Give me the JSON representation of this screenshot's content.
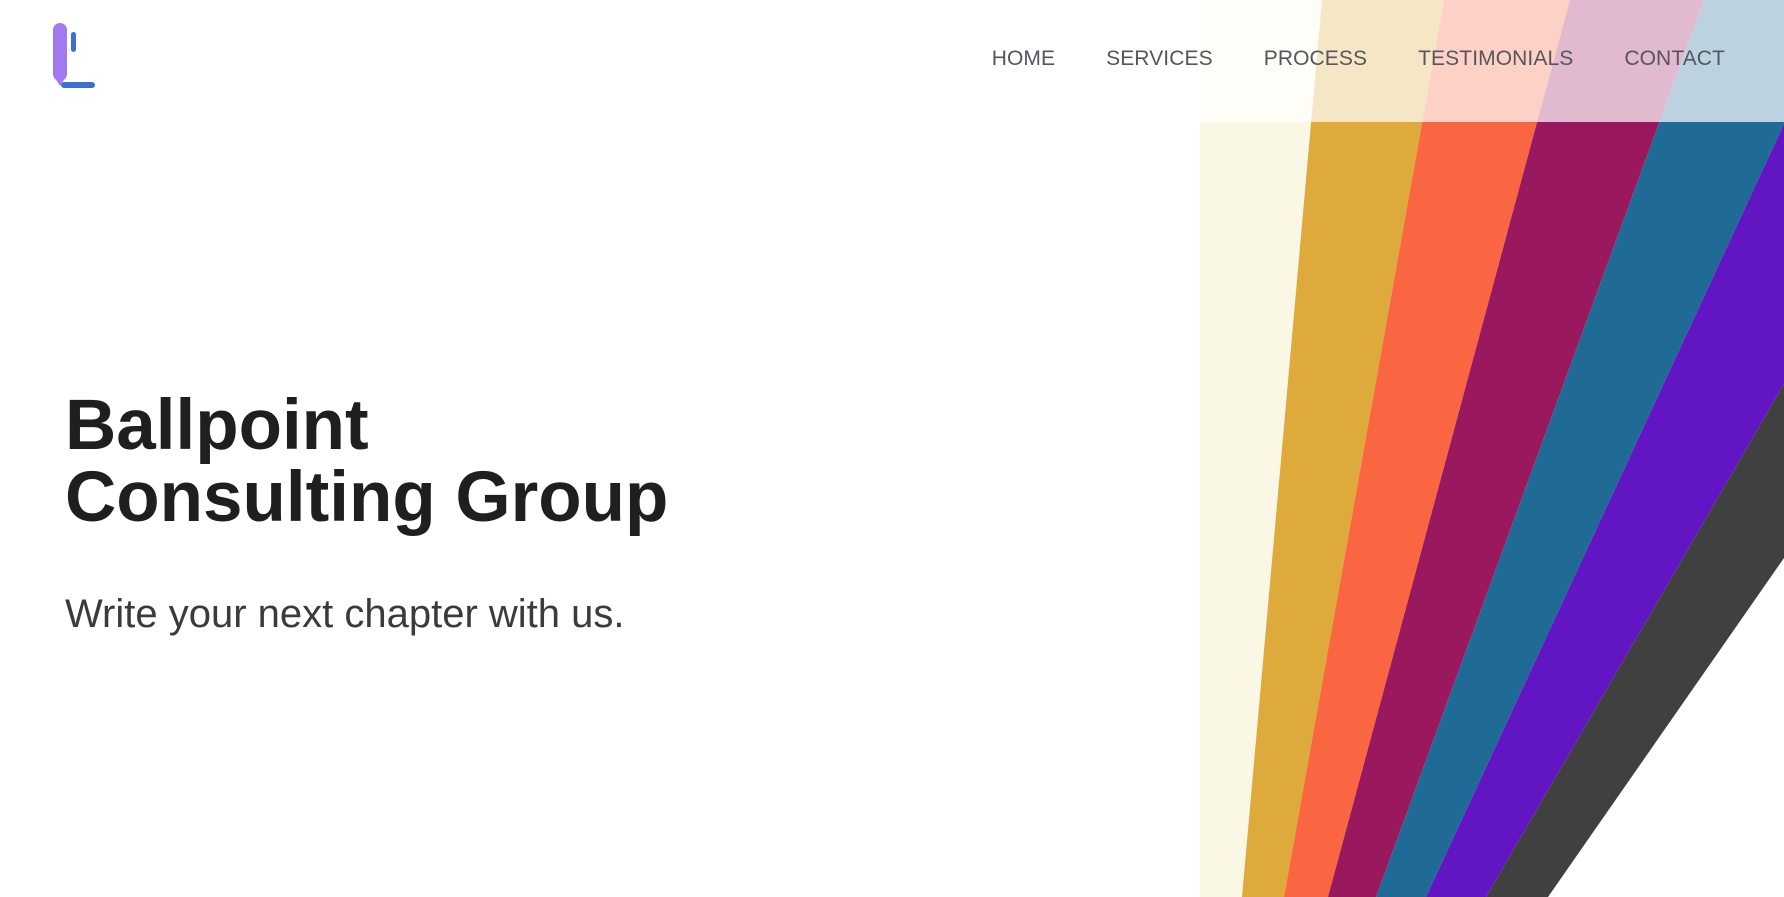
{
  "brand": {
    "logo_icon": "ballpoint-pen-logo-icon",
    "colors": {
      "logo_primary": "#a27af0",
      "logo_secondary": "#3b6fd6"
    }
  },
  "nav": {
    "items": [
      {
        "label": "HOME"
      },
      {
        "label": "SERVICES"
      },
      {
        "label": "PROCESS"
      },
      {
        "label": "TESTIMONIALS"
      },
      {
        "label": "CONTACT"
      }
    ]
  },
  "hero": {
    "title_line1": "Ballpoint",
    "title_line2": "Consulting Group",
    "subtitle": "Write your next chapter with us."
  },
  "decoration": {
    "stripe_colors": [
      "#faf8e4",
      "#deaa3c",
      "#fb6642",
      "#9a185e",
      "#206a96",
      "#6215c2",
      "#404040"
    ]
  }
}
